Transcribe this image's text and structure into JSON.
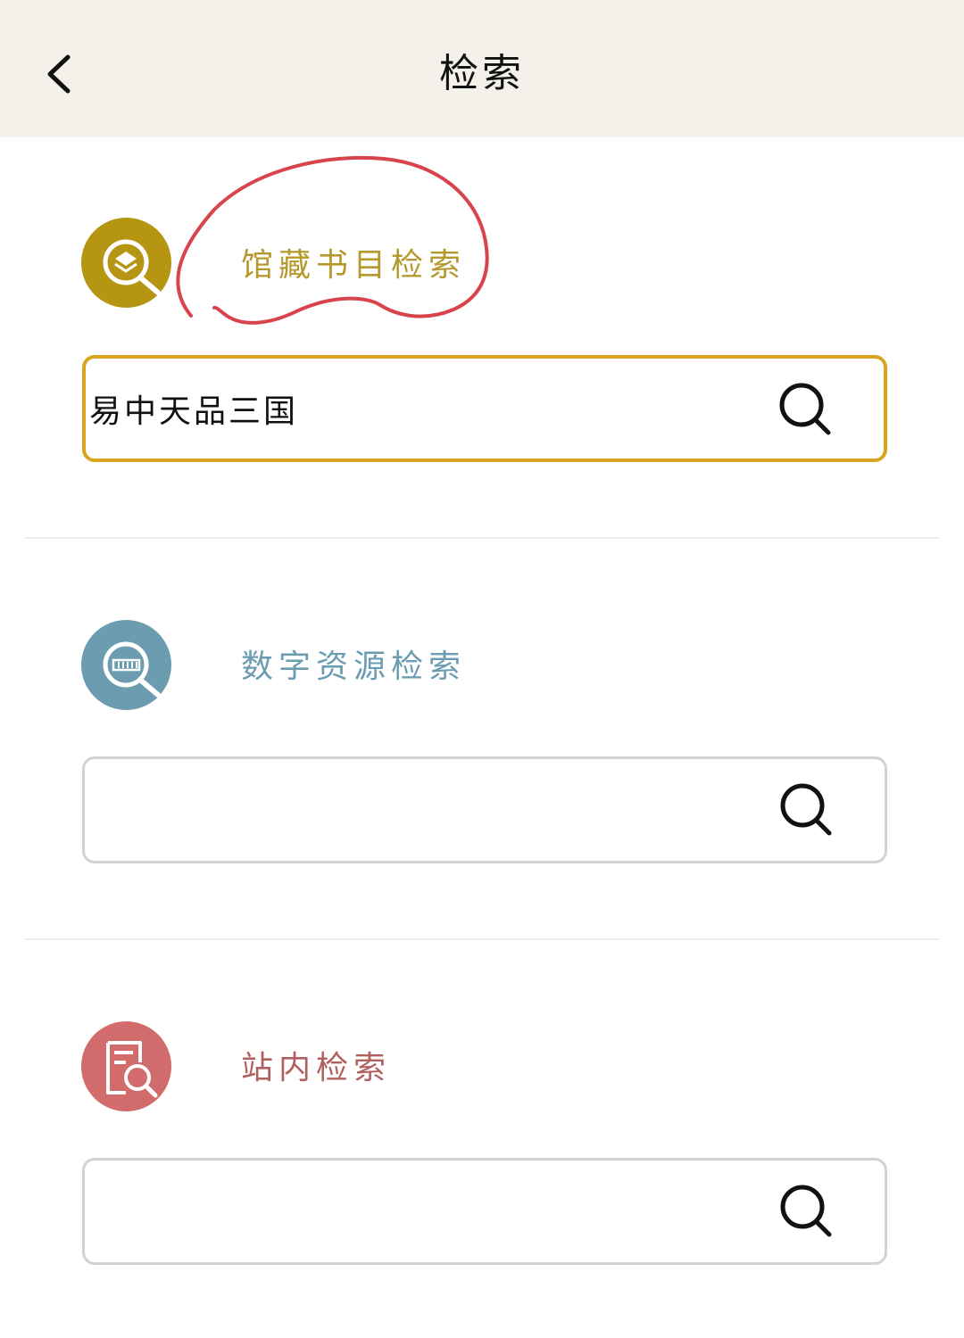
{
  "header": {
    "title": "检索"
  },
  "sections": [
    {
      "title": "馆藏书目检索",
      "icon": "catalog-search-icon",
      "color": "#b59512",
      "title_color": "#b49a2c",
      "input_value": "易中天品三国",
      "input_placeholder": ""
    },
    {
      "title": "数字资源检索",
      "icon": "digital-resource-search-icon",
      "color": "#6c9cb0",
      "title_color": "#6b9db2",
      "input_value": "",
      "input_placeholder": ""
    },
    {
      "title": "站内检索",
      "icon": "site-search-icon",
      "color": "#d26b6b",
      "title_color": "#b0605e",
      "input_value": "",
      "input_placeholder": ""
    }
  ],
  "colors": {
    "active_border": "#d9a521",
    "inactive_border": "#d2d2d2",
    "header_bg": "#f4f1ea",
    "annotation": "#d9434b"
  }
}
